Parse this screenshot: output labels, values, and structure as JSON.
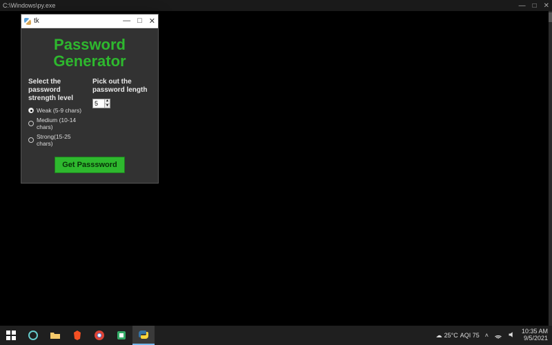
{
  "console": {
    "title": "C:\\Windows\\py.exe"
  },
  "tk": {
    "title": "tk"
  },
  "app": {
    "title_line1": "Password",
    "title_line2": "Generator",
    "strength_label": "Select the password strength level",
    "length_label": "Pick out the password length",
    "options": [
      {
        "label": "Weak (5-9 chars)",
        "selected": true
      },
      {
        "label": "Medium (10-14 chars)",
        "selected": false
      },
      {
        "label": "Strong(15-25 chars)",
        "selected": false
      }
    ],
    "length_value": "5",
    "button_label": "Get Passsword"
  },
  "tray": {
    "temp": "25°C",
    "aqi": "AQI 75",
    "time": "10:35 AM",
    "date": "9/5/2021"
  }
}
